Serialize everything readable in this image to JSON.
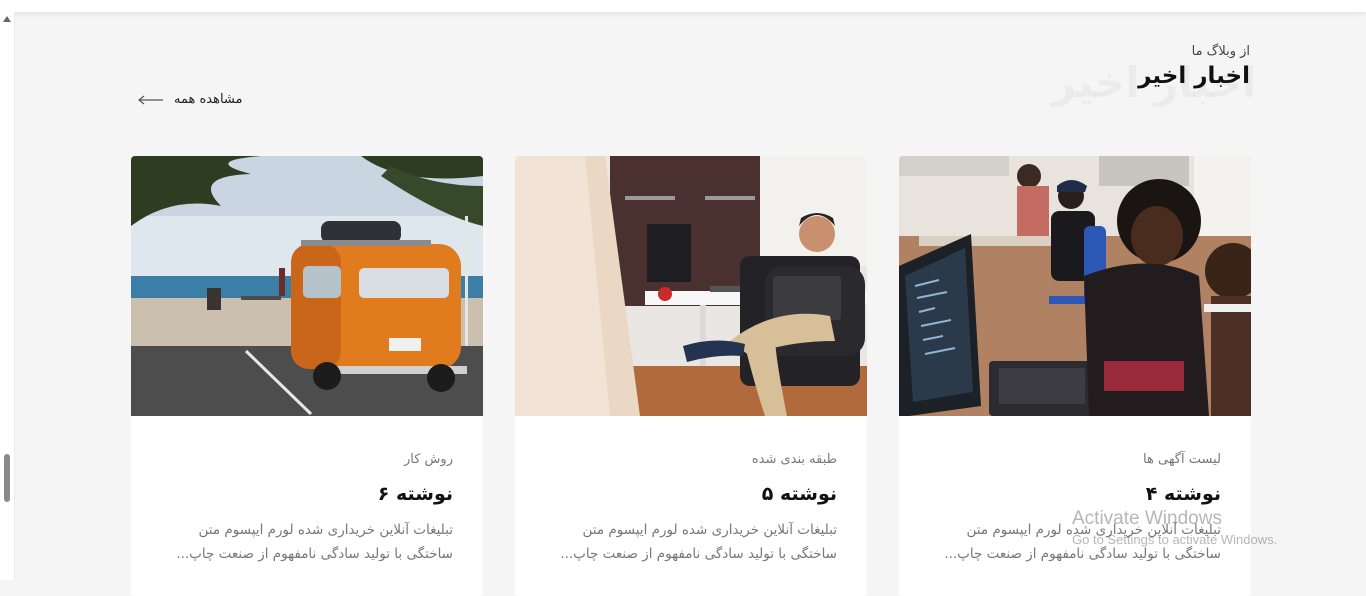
{
  "header": {
    "subtitle": "از وبلاگ ما",
    "title": "اخبار اخیر",
    "watermark": "اخبار اخیر",
    "view_all": "مشاهده همه"
  },
  "cards": [
    {
      "category": "روش کار",
      "title": "نوشته ۶",
      "excerpt": "تبلیغات آنلاین خریداری شده لورم ایپسوم متن ساختگی با تولید سادگی نامفهوم از صنعت چاپ...",
      "image": "orange-van-beach-photo"
    },
    {
      "category": "طبقه بندی شده",
      "title": "نوشته ۵",
      "excerpt": "تبلیغات آنلاین خریداری شده لورم ایپسوم متن ساختگی با تولید سادگی نامفهوم از صنعت چاپ...",
      "image": "man-with-laptop-office-photo"
    },
    {
      "category": "لیست آگهی ها",
      "title": "نوشته ۴",
      "excerpt": "تبلیغات آنلاین خریداری شده لورم ایپسوم متن ساختگی با تولید سادگی نامفهوم از صنعت چاپ...",
      "image": "people-coding-laptops-photo"
    }
  ],
  "windows_watermark": {
    "line1": "Activate Windows",
    "line2": "Go to Settings to activate Windows."
  },
  "colors": {
    "background": "#f5f5f5",
    "card": "#ffffff",
    "title": "#111111",
    "muted": "#777777"
  }
}
